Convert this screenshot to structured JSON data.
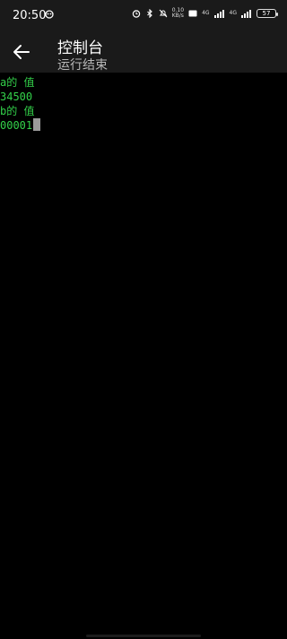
{
  "status_bar": {
    "time": "20:50",
    "speed": "0.10\nKB/s",
    "sim1": "4G",
    "sim2": "4G",
    "battery": "57",
    "icons": [
      "alarm-icon",
      "bluetooth-icon",
      "mute-icon",
      "hd-icon",
      "signal-icon",
      "battery-icon"
    ]
  },
  "app_bar": {
    "title": "控制台",
    "subtitle": "运行结束"
  },
  "console": {
    "lines": [
      "a的 值",
      "34500",
      "b的 值",
      "00001"
    ],
    "text_color": "#33d14a"
  },
  "colors": {
    "background": "#000000",
    "bar": "#1a1a1a"
  }
}
